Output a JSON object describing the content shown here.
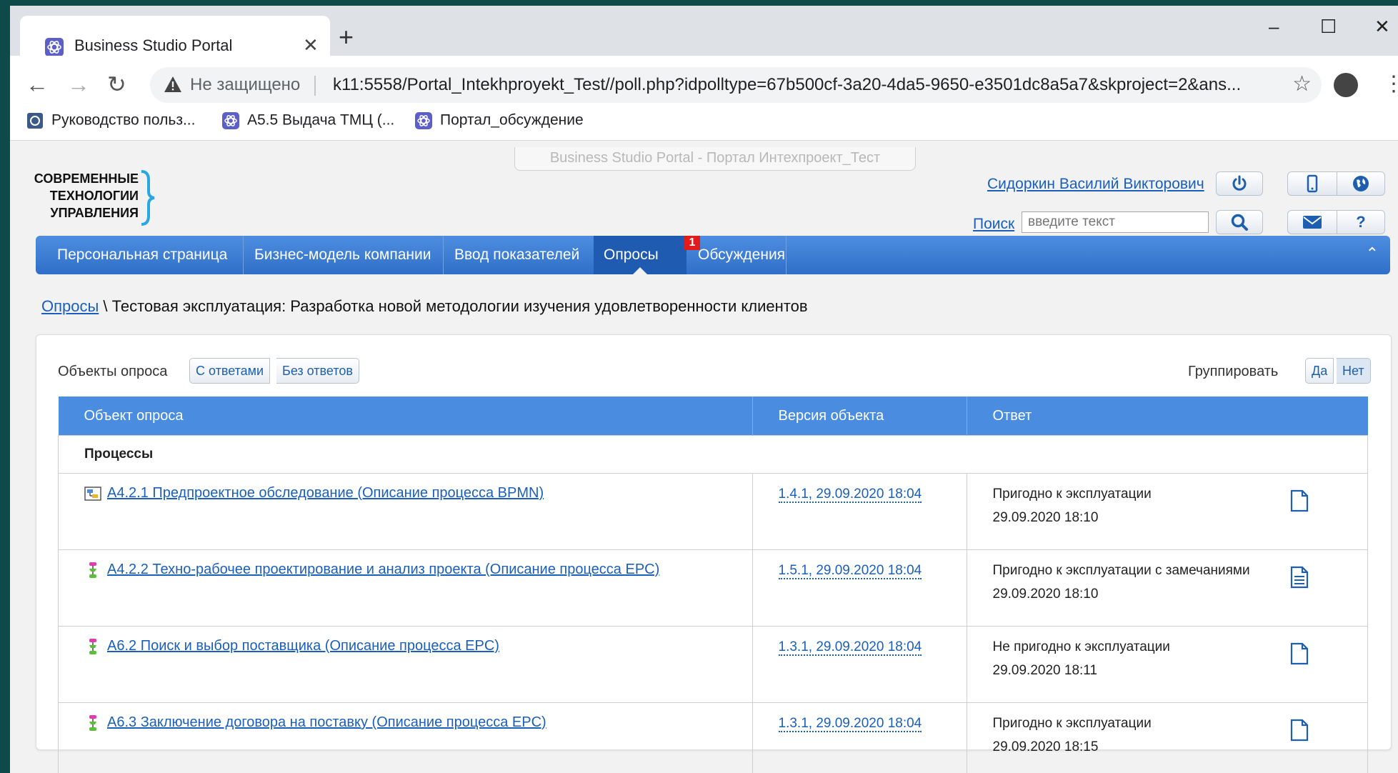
{
  "browser": {
    "tab_title": "Business Studio Portal",
    "tab_close": "✕",
    "new_tab": "+",
    "window_controls": {
      "minimize": "–",
      "maximize": "☐",
      "close": "✕"
    },
    "nav": {
      "back": "←",
      "forward": "→",
      "reload": "↻"
    },
    "security_label": "Не защищено",
    "url": "k11:5558/Portal_Intekhproyekt_Test//poll.php?idpolltype=67b500cf-3a20-4da5-9650-e3501dc8a5a7&skproject=2&ans...",
    "star": "☆",
    "menu": "⋮",
    "bookmarks": [
      {
        "label": "Руководство польз...",
        "icon": "help-book-icon"
      },
      {
        "label": "А5.5 Выдача ТМЦ (...",
        "icon": "portal-favicon"
      },
      {
        "label": "Портал_обсуждение",
        "icon": "portal-favicon"
      }
    ]
  },
  "header": {
    "portal_title": "Business Studio Portal - Портал Интехпроект_Тест",
    "logo_lines": [
      "СОВРЕМЕННЫЕ",
      "ТЕХНОЛОГИИ",
      "УПРАВЛЕНИЯ"
    ],
    "user_name": "Сидоркин Василий Викторович",
    "search_link": "Поиск",
    "search_placeholder": "введите текст",
    "help_label": "?",
    "accent_color": "#2f6fc8"
  },
  "nav": {
    "items": [
      {
        "label": "Персональная страница"
      },
      {
        "label": "Бизнес-модель компании"
      },
      {
        "label": "Ввод показателей"
      },
      {
        "label": "Опросы",
        "active": true
      },
      {
        "label": "Обсуждения"
      }
    ],
    "badge": "1",
    "collapse": "⌃"
  },
  "breadcrumb": {
    "link": "Опросы",
    "separator": " \\ ",
    "current": "Тестовая эксплуатация: Разработка новой методологии изучения удовлетворенности клиентов"
  },
  "filters": {
    "label": "Объекты опроса",
    "with_answers": "С ответами",
    "without_answers": "Без ответов",
    "group_label": "Группировать",
    "yes": "Да",
    "no": "Нет"
  },
  "table": {
    "headers": [
      "Объект опроса",
      "Версия объекта",
      "Ответ"
    ],
    "group": "Процессы",
    "rows": [
      {
        "object": "А4.2.1 Предпроектное обследование (Описание процесса BPMN)",
        "icon": "bpmn-process-icon",
        "version": "1.4.1, 29.09.2020 18:04",
        "answer": "Пригодно к эксплуатации",
        "date": "29.09.2020 18:10",
        "doc": "empty-document-icon"
      },
      {
        "object": "А4.2.2 Техно-рабочее проектирование и анализ проекта (Описание процесса EPC)",
        "icon": "epc-process-icon",
        "version": "1.5.1, 29.09.2020 18:04",
        "answer": "Пригодно к эксплуатации с замечаниями",
        "date": "29.09.2020 18:10",
        "doc": "text-document-icon"
      },
      {
        "object": "А6.2 Поиск и выбор поставщика (Описание процесса EPC)",
        "icon": "epc-process-icon",
        "version": "1.3.1, 29.09.2020 18:04",
        "answer": "Не пригодно к эксплуатации",
        "date": "29.09.2020 18:11",
        "doc": "empty-document-icon"
      },
      {
        "object": "А6.3 Заключение договора на поставку (Описание процесса EPC)",
        "icon": "epc-process-icon",
        "version": "1.3.1, 29.09.2020 18:04",
        "answer": "Пригодно к эксплуатации",
        "date": "29.09.2020 18:15",
        "doc": "empty-document-icon"
      }
    ]
  }
}
